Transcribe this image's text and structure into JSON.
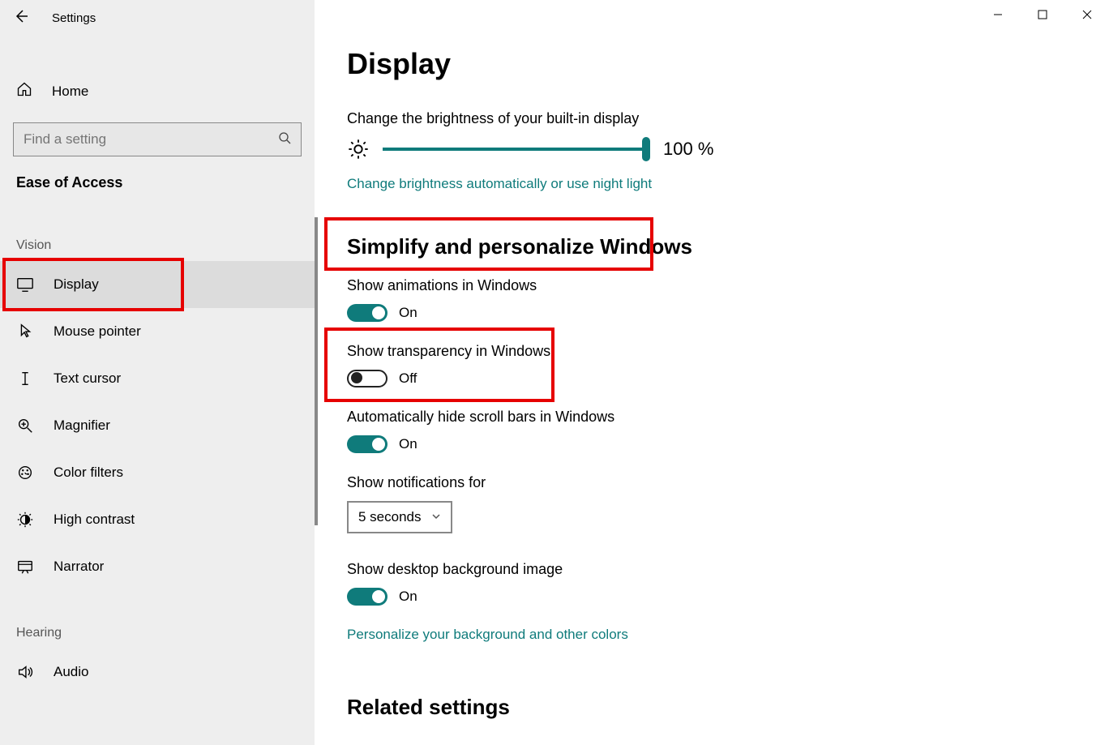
{
  "window": {
    "title": "Settings"
  },
  "sidebar": {
    "home": "Home",
    "search_placeholder": "Find a setting",
    "category": "Ease of Access",
    "group_vision": "Vision",
    "group_hearing": "Hearing",
    "items": {
      "display": "Display",
      "mouse": "Mouse pointer",
      "cursor": "Text cursor",
      "magnifier": "Magnifier",
      "colorfilters": "Color filters",
      "highcontrast": "High contrast",
      "narrator": "Narrator",
      "audio": "Audio"
    }
  },
  "main": {
    "title": "Display",
    "brightness_label": "Change the brightness of your built-in display",
    "brightness_value": "100 %",
    "brightness_link": "Change brightness automatically or use night light",
    "section_simplify": "Simplify and personalize Windows",
    "animations_label": "Show animations in Windows",
    "animations_state": "On",
    "transparency_label": "Show transparency in Windows",
    "transparency_state": "Off",
    "scrollbars_label": "Automatically hide scroll bars in Windows",
    "scrollbars_state": "On",
    "notifications_label": "Show notifications for",
    "notifications_value": "5 seconds",
    "desktopbg_label": "Show desktop background image",
    "desktopbg_state": "On",
    "personalize_link": "Personalize your background and other colors",
    "related_heading": "Related settings"
  }
}
